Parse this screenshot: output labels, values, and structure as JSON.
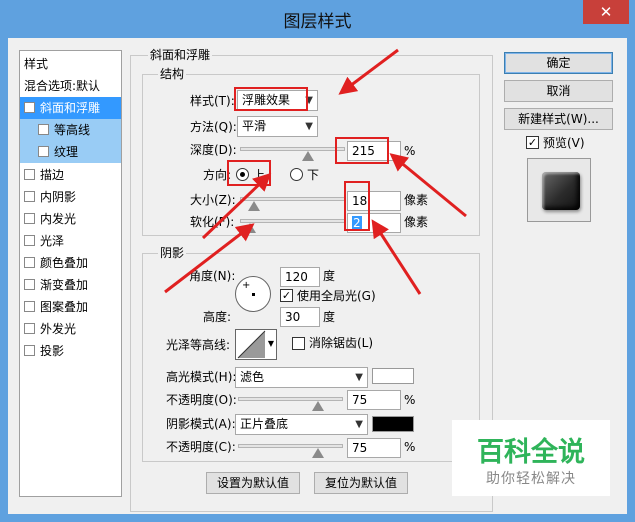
{
  "window": {
    "title": "图层样式",
    "close": "✕"
  },
  "sidebar": {
    "items": [
      {
        "label": "样式"
      },
      {
        "label": "混合选项:默认"
      },
      {
        "label": "斜面和浮雕",
        "checked": true
      },
      {
        "label": "等高线",
        "checked": false
      },
      {
        "label": "纹理",
        "checked": false
      },
      {
        "label": "描边",
        "checked": false
      },
      {
        "label": "内阴影",
        "checked": false
      },
      {
        "label": "内发光",
        "checked": false
      },
      {
        "label": "光泽",
        "checked": false
      },
      {
        "label": "颜色叠加",
        "checked": false
      },
      {
        "label": "渐变叠加",
        "checked": false
      },
      {
        "label": "图案叠加",
        "checked": false
      },
      {
        "label": "外发光",
        "checked": false
      },
      {
        "label": "投影",
        "checked": false
      }
    ]
  },
  "bevel": {
    "group_title": "斜面和浮雕",
    "structure_title": "结构",
    "style_label": "样式(T):",
    "style_value": "浮雕效果",
    "technique_label": "方法(Q):",
    "technique_value": "平滑",
    "depth_label": "深度(D):",
    "depth_value": "215",
    "depth_unit": "%",
    "direction_label": "方向:",
    "direction_up": "上",
    "direction_down": "下",
    "size_label": "大小(Z):",
    "size_value": "18",
    "size_unit": "像素",
    "soften_label": "软化(F):",
    "soften_value": "2",
    "soften_unit": "像素",
    "shading_title": "阴影",
    "angle_label": "角度(N):",
    "angle_value": "120",
    "angle_unit": "度",
    "global_light_label": "使用全局光(G)",
    "altitude_label": "高度:",
    "altitude_value": "30",
    "altitude_unit": "度",
    "gloss_contour_label": "光泽等高线:",
    "anti_alias_label": "消除锯齿(L)",
    "highlight_mode_label": "高光模式(H):",
    "highlight_mode_value": "滤色",
    "highlight_color": "#ffffff",
    "highlight_opacity_label": "不透明度(O):",
    "highlight_opacity_value": "75",
    "highlight_opacity_unit": "%",
    "shadow_mode_label": "阴影模式(A):",
    "shadow_mode_value": "正片叠底",
    "shadow_color": "#000000",
    "shadow_opacity_label": "不透明度(C):",
    "shadow_opacity_value": "75",
    "shadow_opacity_unit": "%",
    "make_default": "设置为默认值",
    "reset_default": "复位为默认值"
  },
  "buttons": {
    "ok": "确定",
    "cancel": "取消",
    "new_style": "新建样式(W)...",
    "preview": "预览(V)"
  },
  "watermark": {
    "line1": "百科全说",
    "line2": "助你轻松解决"
  },
  "colors": {
    "accent": "#3399ff",
    "annotation": "#e02020",
    "watermark": "#2fb45a"
  }
}
